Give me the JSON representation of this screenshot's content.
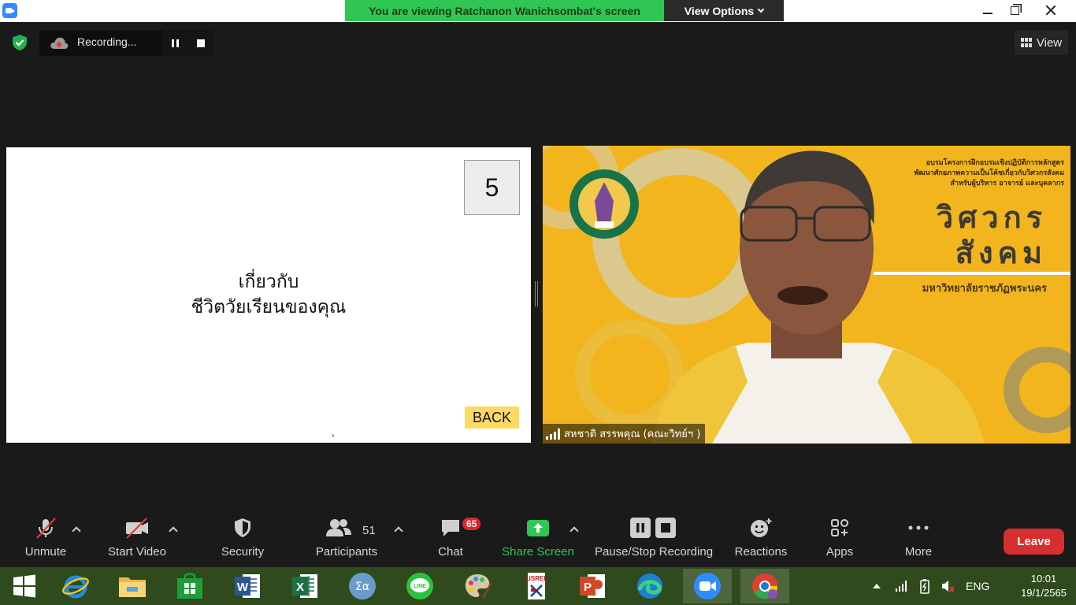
{
  "window": {
    "banner_text": "You are viewing Ratchanon Wanichsombat's screen",
    "view_options_label": "View Options"
  },
  "topbar": {
    "recording_label": "Recording...",
    "view_label": "View"
  },
  "slide": {
    "number": "5",
    "line1": "เกี่ยวกับ",
    "line2": "ชีวิตวัยเรียนของคุณ",
    "back_label": "BACK"
  },
  "video": {
    "participant_name": "สหชาติ สรรพคุณ (คณะวิทย์ฯ )",
    "background_heading_1": "อบรมโครงการฝึกอบรมเชิงปฏิบัติการหลักสูตร",
    "background_heading_2": "พัฒนาศักยภาพความเป็นโค้ชเกี่ยวกับวิศวกรสังคม",
    "background_heading_3": "สำหรับผู้บริหาร อาจารย์ และบุคลากร",
    "background_title_1": "วิศวกร",
    "background_title_2": "สังคม",
    "background_university": "มหาวิทยาลัยราชภัฏพระนคร"
  },
  "toolbar": {
    "unmute_label": "Unmute",
    "start_video_label": "Start Video",
    "security_label": "Security",
    "participants_label": "Participants",
    "participants_count": "51",
    "chat_label": "Chat",
    "chat_badge": "65",
    "share_screen_label": "Share Screen",
    "pause_stop_recording_label": "Pause/Stop Recording",
    "reactions_label": "Reactions",
    "apps_label": "Apps",
    "more_label": "More",
    "leave_label": "Leave"
  },
  "taskbar": {
    "language": "ENG",
    "time": "10:01",
    "date": "19/1/2565",
    "apps": [
      "windows-start",
      "internet-explorer",
      "file-explorer",
      "microsoft-store",
      "word",
      "excel",
      "math-input",
      "line",
      "paint",
      "lisrel",
      "powerpoint",
      "edge",
      "zoom",
      "chrome"
    ]
  },
  "colors": {
    "banner_green": "#2fc653",
    "leave_red": "#d62f2f",
    "chat_badge_red": "#e02828",
    "back_button_yellow": "#ffd966",
    "video_background_yellow": "#f2b51d",
    "taskbar_green": "#2f4a1c"
  }
}
